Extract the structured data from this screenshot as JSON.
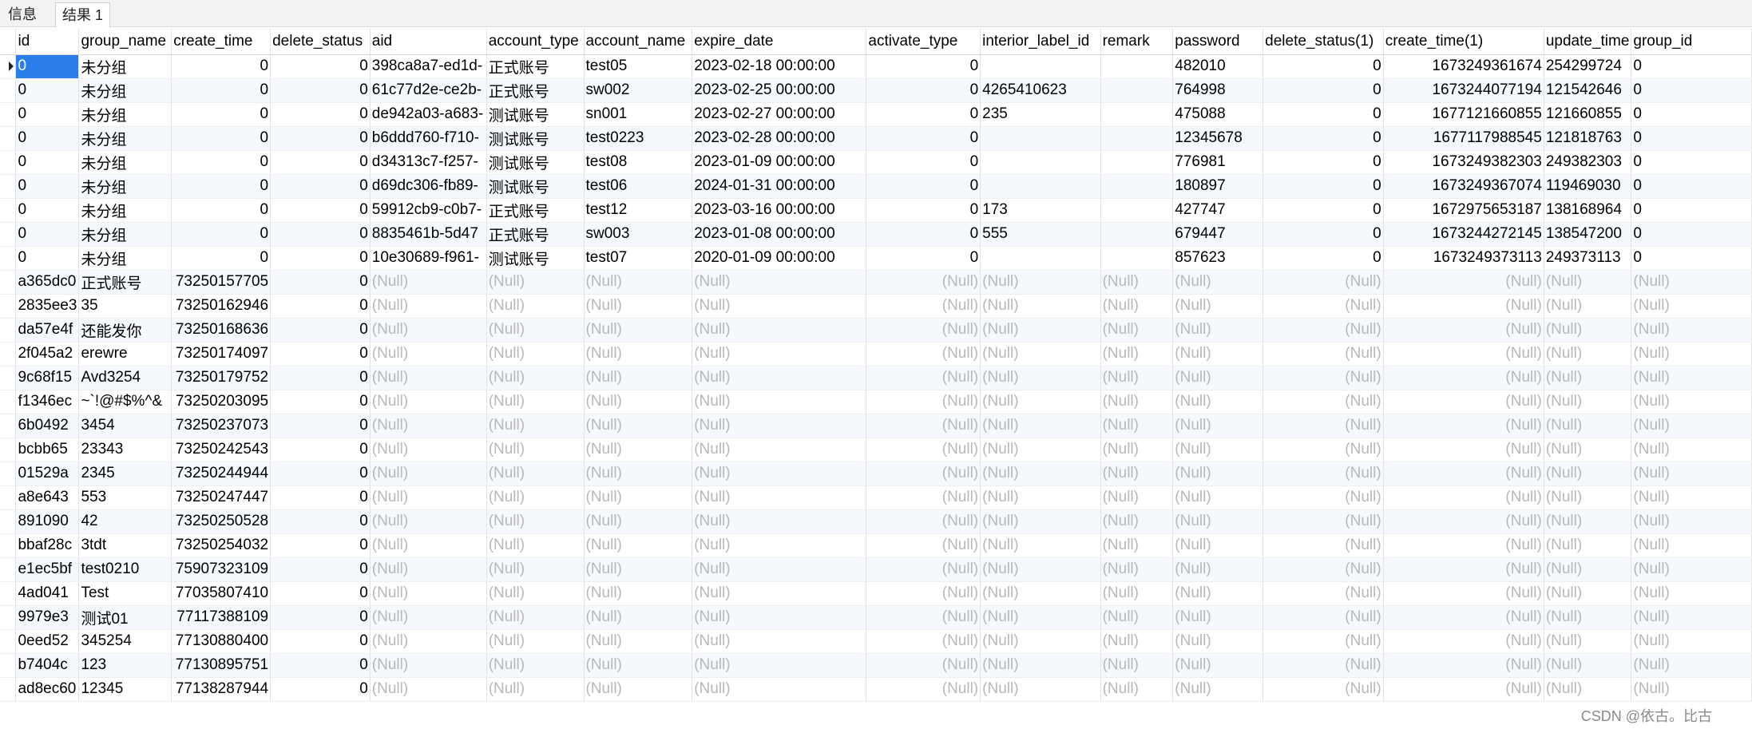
{
  "tabs": [
    {
      "label": "信息",
      "active": false
    },
    {
      "label": "结果 1",
      "active": true
    }
  ],
  "grid": {
    "null_text": "(Null)",
    "columns": [
      {
        "name": "id",
        "width": 72,
        "align": "left"
      },
      {
        "name": "group_name",
        "width": 116,
        "align": "left"
      },
      {
        "name": "create_time",
        "width": 124,
        "align": "right"
      },
      {
        "name": "delete_status",
        "width": 125,
        "align": "right"
      },
      {
        "name": "aid",
        "width": 146,
        "align": "left"
      },
      {
        "name": "account_type",
        "width": 122,
        "align": "left"
      },
      {
        "name": "account_name",
        "width": 136,
        "align": "left"
      },
      {
        "name": "expire_date",
        "width": 220,
        "align": "left"
      },
      {
        "name": "activate_type",
        "width": 144,
        "align": "right"
      },
      {
        "name": "interior_label_id",
        "width": 151,
        "align": "left"
      },
      {
        "name": "remark",
        "width": 92,
        "align": "left"
      },
      {
        "name": "password",
        "width": 114,
        "align": "left"
      },
      {
        "name": "delete_status(1)",
        "width": 151,
        "align": "right"
      },
      {
        "name": "create_time(1)",
        "width": 204,
        "align": "right"
      },
      {
        "name": "update_time",
        "width": 102,
        "align": "left"
      },
      {
        "name": "group_id",
        "width": 154,
        "align": "left"
      }
    ],
    "rows": [
      [
        "0",
        "未分组",
        "0",
        "0",
        "398ca8a7-ed1d-",
        "正式账号",
        "test05",
        "2023-02-18 00:00:00",
        "0",
        "",
        "",
        "482010",
        "0",
        "1673249361674",
        "254299724",
        "0"
      ],
      [
        "0",
        "未分组",
        "0",
        "0",
        "61c77d2e-ce2b-",
        "正式账号",
        "sw002",
        "2023-02-25 00:00:00",
        "0",
        "4265410623",
        "",
        "764998",
        "0",
        "1673244077194",
        "121542646",
        "0"
      ],
      [
        "0",
        "未分组",
        "0",
        "0",
        "de942a03-a683-",
        "测试账号",
        "sn001",
        "2023-02-27 00:00:00",
        "0",
        "235",
        "",
        "475088",
        "0",
        "1677121660855",
        "121660855",
        "0"
      ],
      [
        "0",
        "未分组",
        "0",
        "0",
        "b6ddd760-f710-",
        "测试账号",
        "test0223",
        "2023-02-28 00:00:00",
        "0",
        "",
        "",
        "12345678",
        "0",
        "1677117988545",
        "121818763",
        "0"
      ],
      [
        "0",
        "未分组",
        "0",
        "0",
        "d34313c7-f257-",
        "测试账号",
        "test08",
        "2023-01-09 00:00:00",
        "0",
        "",
        "",
        "776981",
        "0",
        "1673249382303",
        "249382303",
        "0"
      ],
      [
        "0",
        "未分组",
        "0",
        "0",
        "d69dc306-fb89-",
        "测试账号",
        "test06",
        "2024-01-31 00:00:00",
        "0",
        "",
        "",
        "180897",
        "0",
        "1673249367074",
        "119469030",
        "0"
      ],
      [
        "0",
        "未分组",
        "0",
        "0",
        "59912cb9-c0b7-",
        "正式账号",
        "test12",
        "2023-03-16 00:00:00",
        "0",
        "173",
        "",
        "427747",
        "0",
        "1672975653187",
        "138168964",
        "0"
      ],
      [
        "0",
        "未分组",
        "0",
        "0",
        "8835461b-5d47",
        "正式账号",
        "sw003",
        "2023-01-08 00:00:00",
        "0",
        "555",
        "",
        "679447",
        "0",
        "1673244272145",
        "138547200",
        "0"
      ],
      [
        "0",
        "未分组",
        "0",
        "0",
        "10e30689-f961-",
        "测试账号",
        "test07",
        "2020-01-09 00:00:00",
        "0",
        "",
        "",
        "857623",
        "0",
        "1673249373113",
        "249373113",
        "0"
      ],
      [
        "a365dc0",
        "正式账号",
        "73250157705",
        "0",
        null,
        null,
        null,
        null,
        null,
        null,
        null,
        null,
        null,
        null,
        null,
        null
      ],
      [
        "2835ee3",
        "35",
        "73250162946",
        "0",
        null,
        null,
        null,
        null,
        null,
        null,
        null,
        null,
        null,
        null,
        null,
        null
      ],
      [
        "da57e4f",
        "还能发你",
        "73250168636",
        "0",
        null,
        null,
        null,
        null,
        null,
        null,
        null,
        null,
        null,
        null,
        null,
        null
      ],
      [
        "2f045a2",
        "erewre",
        "73250174097",
        "0",
        null,
        null,
        null,
        null,
        null,
        null,
        null,
        null,
        null,
        null,
        null,
        null
      ],
      [
        "9c68f15",
        "Avd3254",
        "73250179752",
        "0",
        null,
        null,
        null,
        null,
        null,
        null,
        null,
        null,
        null,
        null,
        null,
        null
      ],
      [
        "f1346ec",
        "~`!@#$%^&",
        "73250203095",
        "0",
        null,
        null,
        null,
        null,
        null,
        null,
        null,
        null,
        null,
        null,
        null,
        null
      ],
      [
        "6b0492",
        "3454",
        "73250237073",
        "0",
        null,
        null,
        null,
        null,
        null,
        null,
        null,
        null,
        null,
        null,
        null,
        null
      ],
      [
        "bcbb65",
        "23343",
        "73250242543",
        "0",
        null,
        null,
        null,
        null,
        null,
        null,
        null,
        null,
        null,
        null,
        null,
        null
      ],
      [
        "01529a",
        "2345",
        "73250244944",
        "0",
        null,
        null,
        null,
        null,
        null,
        null,
        null,
        null,
        null,
        null,
        null,
        null
      ],
      [
        "a8e643",
        "553",
        "73250247447",
        "0",
        null,
        null,
        null,
        null,
        null,
        null,
        null,
        null,
        null,
        null,
        null,
        null
      ],
      [
        "891090",
        "42",
        "73250250528",
        "0",
        null,
        null,
        null,
        null,
        null,
        null,
        null,
        null,
        null,
        null,
        null,
        null
      ],
      [
        "bbaf28c",
        "3tdt",
        "73250254032",
        "0",
        null,
        null,
        null,
        null,
        null,
        null,
        null,
        null,
        null,
        null,
        null,
        null
      ],
      [
        "e1ec5bf",
        "test0210",
        "75907323109",
        "0",
        null,
        null,
        null,
        null,
        null,
        null,
        null,
        null,
        null,
        null,
        null,
        null
      ],
      [
        "4ad041",
        "Test",
        "77035807410",
        "0",
        null,
        null,
        null,
        null,
        null,
        null,
        null,
        null,
        null,
        null,
        null,
        null
      ],
      [
        "9979e3",
        "测试01",
        "77117388109",
        "0",
        null,
        null,
        null,
        null,
        null,
        null,
        null,
        null,
        null,
        null,
        null,
        null
      ],
      [
        "0eed52",
        "345254",
        "77130880400",
        "0",
        null,
        null,
        null,
        null,
        null,
        null,
        null,
        null,
        null,
        null,
        null,
        null
      ],
      [
        "b7404c",
        "123",
        "77130895751",
        "0",
        null,
        null,
        null,
        null,
        null,
        null,
        null,
        null,
        null,
        null,
        null,
        null
      ],
      [
        "ad8ec60",
        "12345",
        "77138287944",
        "0",
        null,
        null,
        null,
        null,
        null,
        null,
        null,
        null,
        null,
        null,
        null,
        null
      ]
    ]
  },
  "watermark": "CSDN @依古。比古"
}
